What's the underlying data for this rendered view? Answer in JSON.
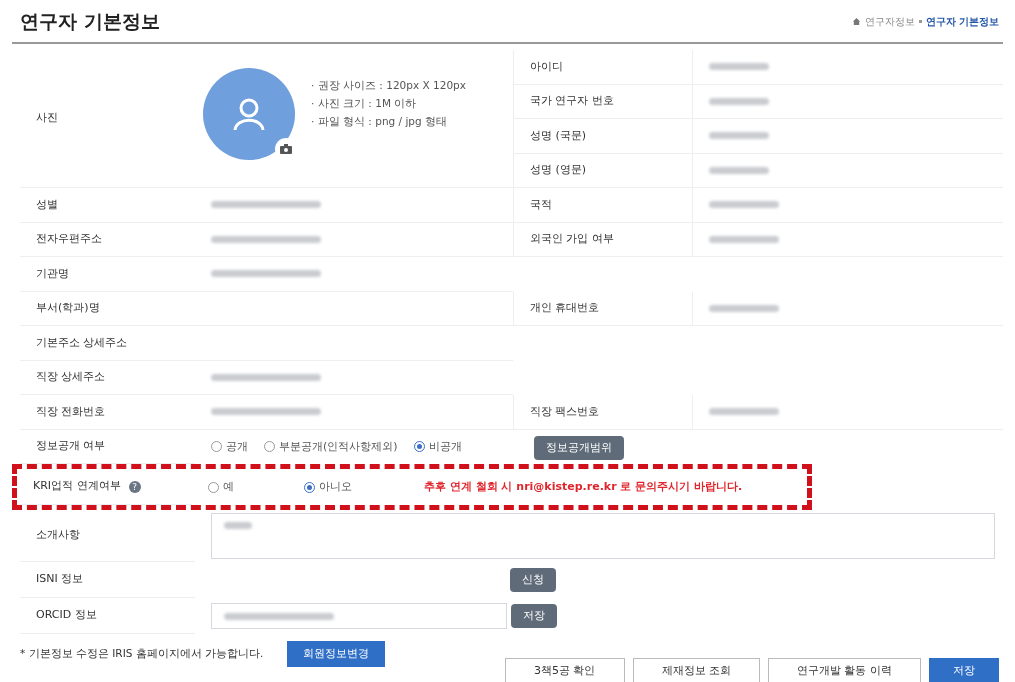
{
  "title": "연구자 기본정보",
  "breadcrumb": [
    {
      "label": "연구자정보",
      "selected": false
    },
    {
      "label": "연구자 기본정보",
      "selected": true
    }
  ],
  "photo": {
    "label": "사진",
    "hints": [
      "· 권장 사이즈 : 120px X 120px",
      "· 사진 크기 : 1M 이하",
      "· 파일 형식 : png / jpg 형태"
    ]
  },
  "photo_side_fields": [
    {
      "label": "아이디",
      "value_hidden": true
    },
    {
      "label": "국가 연구자 번호",
      "value_hidden": true
    },
    {
      "label": "성명 (국문)",
      "value_hidden": true
    },
    {
      "label": "성명 (영문)",
      "value_hidden": true
    }
  ],
  "rows": [
    {
      "kind": "field",
      "label": "성별",
      "value_hidden": true,
      "right": {
        "label": "국적",
        "value_hidden": true
      }
    },
    {
      "kind": "field",
      "label": "전자우편주소",
      "value_hidden": true,
      "right": {
        "label": "외국인 가입 여부",
        "value_hidden": true
      }
    },
    {
      "kind": "field",
      "label": "기관명",
      "value_hidden": true
    },
    {
      "kind": "field",
      "label": "부서(학과)명",
      "value_hidden": false,
      "right": {
        "label": "개인 휴대번호",
        "value_hidden": true
      }
    },
    {
      "kind": "field",
      "label": "기본주소 상세주소",
      "value_hidden": false
    },
    {
      "kind": "field",
      "label": "직장 상세주소",
      "value_hidden": true
    },
    {
      "kind": "field",
      "label": "직장 전화번호",
      "value_hidden": true,
      "right": {
        "label": "직장 팩스번호",
        "value_hidden": true
      }
    },
    {
      "kind": "radio",
      "label": "정보공개 여부",
      "options": [
        {
          "label": "공개",
          "selected": false
        },
        {
          "label": "부분공개(인적사항제외)",
          "selected": false
        },
        {
          "label": "비공개",
          "selected": true
        }
      ],
      "button": "정보공개범위"
    },
    {
      "kind": "radio",
      "label": "KRI업적 연계여부",
      "help": "?",
      "highlighted": true,
      "options": [
        {
          "label": "예",
          "selected": false
        },
        {
          "label": "아니오",
          "selected": true
        }
      ],
      "notice": "추후 연계 철회 시 nri@kistep.re.kr 로 문의주시기 바랍니다."
    },
    {
      "kind": "textarea",
      "label": "소개사항",
      "value_hidden": true
    },
    {
      "kind": "button",
      "label": "ISNI 정보",
      "button": "신청"
    },
    {
      "kind": "input",
      "label": "ORCID 정보",
      "value_hidden": true,
      "button": "저장"
    }
  ],
  "footer": {
    "note": "* 기본정보 수정은 IRIS 홈페이지에서 가능합니다.",
    "button": "회원정보변경",
    "actions": [
      {
        "label": "3책5공 확인",
        "kind": "outline"
      },
      {
        "label": "제재정보 조회",
        "kind": "outline"
      },
      {
        "label": "연구개발 활동 이력",
        "kind": "outline"
      },
      {
        "label": "저장",
        "kind": "primary"
      }
    ]
  }
}
